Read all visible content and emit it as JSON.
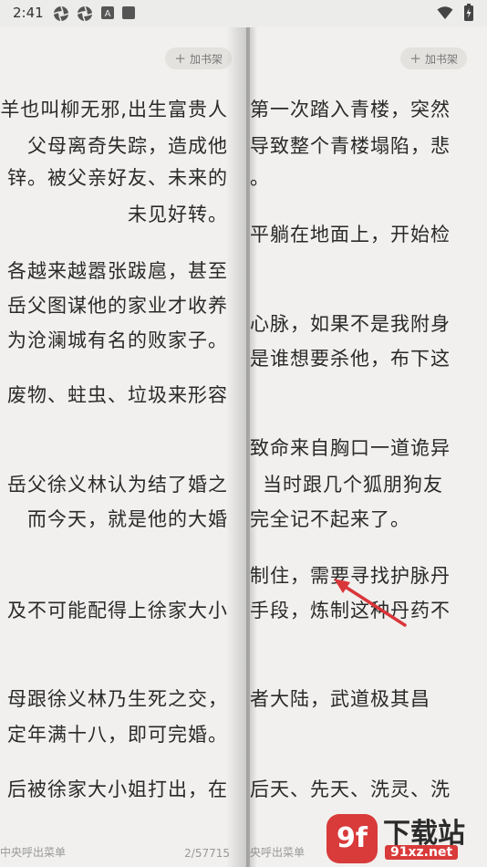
{
  "status_bar": {
    "time": "2:41",
    "icons_left": [
      "aperture-icon",
      "aperture-icon",
      "font-icon",
      "square-app-icon"
    ],
    "icons_right": [
      "wifi-icon",
      "battery-icon"
    ]
  },
  "left_page": {
    "add_shelf_label": "加书架",
    "lines": [
      "羊也叫柳无邪,出生富贵人",
      "父母离奇失踪，造成他",
      "锌。被父亲好友、未来的",
      "未见好转。",
      "各越来越嚣张跋扈，甚至",
      "岳父图谋他的家业才收养",
      "为沧澜城有名的败家子。",
      "废物、蛀虫、垃圾来形容",
      "岳父徐义林认为结了婚之",
      "而今天，就是他的大婚",
      "及不可能配得上徐家大小",
      "母跟徐义林乃生死之交，",
      "定年满十八，即可完婚。",
      "后被徐家大小姐打出，在"
    ],
    "footer_left": "中央呼出菜单",
    "footer_right": "2/57715"
  },
  "right_page": {
    "add_shelf_label": "加书架",
    "lines": [
      "第一次踏入青楼，突然",
      "导致整个青楼塌陷，悲",
      "。",
      "平躺在地面上，开始检",
      "心脉，如果不是我附身",
      "是谁想要杀他，布下这",
      "致命来自胸口一道诡异",
      "当时跟几个狐朋狗友",
      "完全记不起来了。",
      "制住，需要寻找护脉丹",
      "手段，炼制这种丹药不",
      "者大陆，武道极其昌",
      "后天、先天、洗灵、洗"
    ],
    "footer_left": "央呼出菜单"
  },
  "watermark": {
    "badge": "9f",
    "title": "下载站",
    "subtitle": "91xz.net"
  },
  "colors": {
    "paper": "#f1f0ee",
    "text": "#2a2a2a",
    "arrow": "#d9363a",
    "watermark_red": "#d93a3a"
  }
}
